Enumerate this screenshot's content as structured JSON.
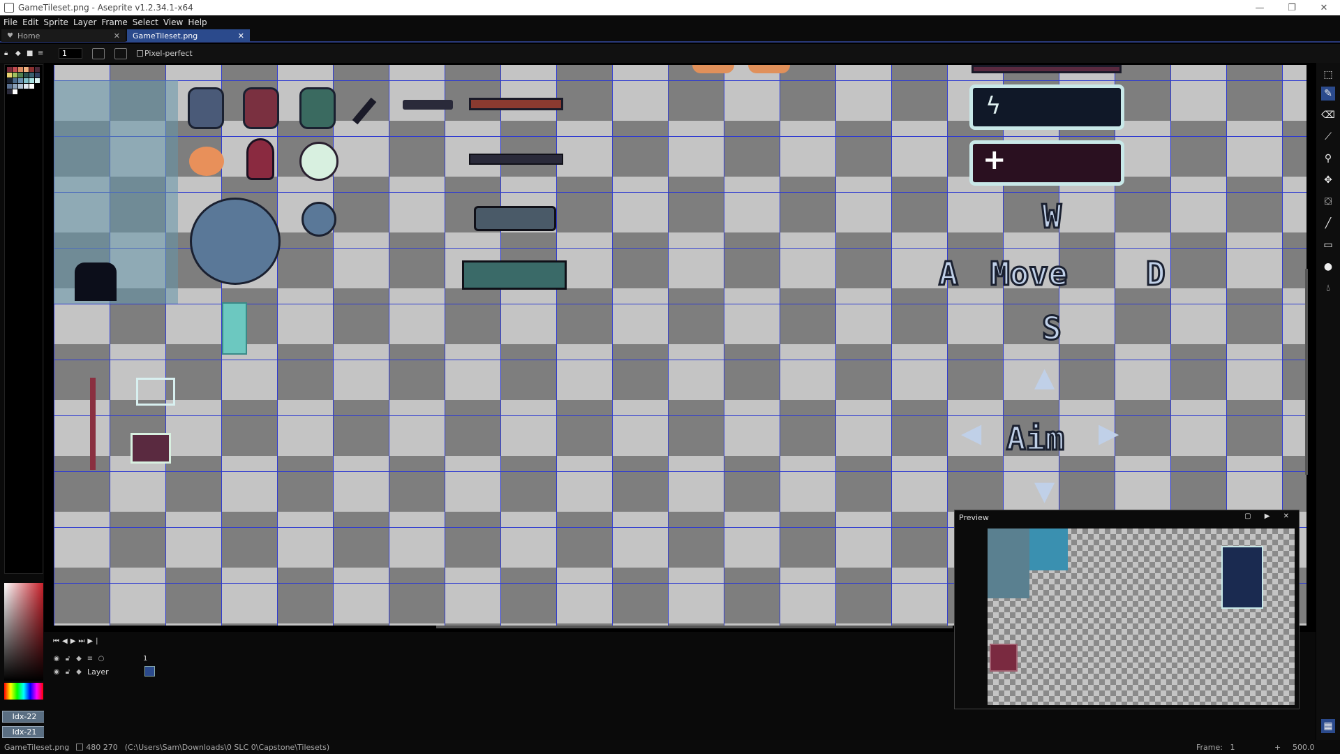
{
  "window": {
    "title": "GameTileset.png - Aseprite v1.2.34.1-x64",
    "minimize": "—",
    "maximize": "❐",
    "close": "✕"
  },
  "menu": [
    "File",
    "Edit",
    "Sprite",
    "Layer",
    "Frame",
    "Select",
    "View",
    "Help"
  ],
  "tabs": {
    "home": "Home",
    "file": "GameTileset.png",
    "close": "✕"
  },
  "toolbar": {
    "brush_size": "1",
    "pixel_perfect": "Pixel-perfect"
  },
  "palette_buttons": {
    "fg_index": "Idx-22",
    "bg_index": "Idx-21"
  },
  "canvas_text": {
    "w": "W",
    "a": "A",
    "move": "Move",
    "d": "D",
    "s": "S",
    "aim": "Aim"
  },
  "timeline": {
    "frame_header": "1",
    "layer_name": "Layer"
  },
  "preview": {
    "title": "Preview",
    "buttons": "▢ ▶ ✕"
  },
  "status": {
    "filename": "GameTileset.png",
    "size": "480 270",
    "path": "(C:\\Users\\Sam\\Downloads\\0 SLC 0\\Capstone\\Tilesets)",
    "frame_label": "Frame:",
    "frame_value": "1",
    "zoom": "500.0"
  },
  "colors": {
    "accent": "#2b4a8c",
    "grid": "#2f3bd0",
    "checker_light": "#c4c4c4",
    "checker_dark": "#7e7e7e"
  }
}
